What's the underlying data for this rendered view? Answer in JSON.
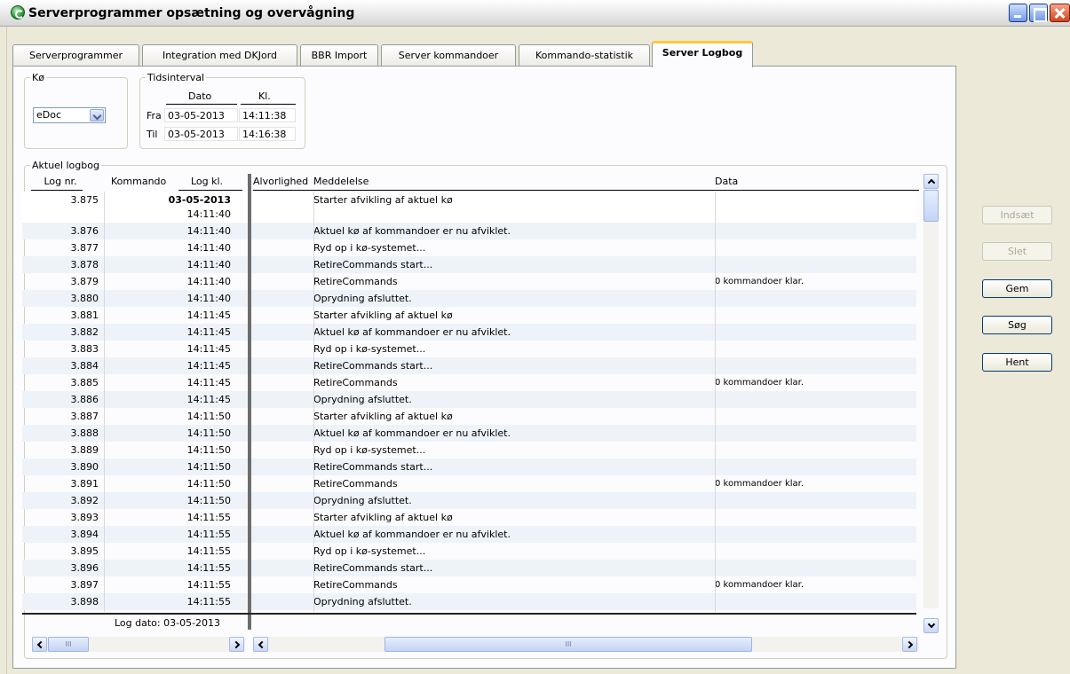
{
  "window": {
    "title": "Serverprogrammer opsætning og overvågning"
  },
  "tabs": [
    {
      "label": "Serverprogrammer"
    },
    {
      "label": "Integration med DKJord"
    },
    {
      "label": "BBR Import"
    },
    {
      "label": "Server kommandoer"
    },
    {
      "label": "Kommando-statistik"
    },
    {
      "label": "Server Logbog",
      "active": true
    }
  ],
  "queue": {
    "legend": "Kø",
    "selected": "eDoc"
  },
  "interval": {
    "legend": "Tidsinterval",
    "col_date": "Dato",
    "col_time": "Kl.",
    "from_label": "Fra",
    "from_date": "03-05-2013",
    "from_time": "14:11:38",
    "to_label": "Til",
    "to_date": "03-05-2013",
    "to_time": "14:16:38"
  },
  "log": {
    "legend": "Aktuel logbog",
    "columns": {
      "nr": "Log nr.",
      "kommando": "Kommando",
      "kl": "Log kl.",
      "alvorlighed": "Alvorlighed",
      "meddelelse": "Meddelelse",
      "data": "Data"
    },
    "first_date": "03-05-2013",
    "rows": [
      {
        "nr": "3.875",
        "kl": "14:11:40",
        "msg": "Starter afvikling af aktuel kø",
        "data": ""
      },
      {
        "nr": "3.876",
        "kl": "14:11:40",
        "msg": "Aktuel kø af kommandoer er nu afviklet.",
        "data": ""
      },
      {
        "nr": "3.877",
        "kl": "14:11:40",
        "msg": "Ryd op i kø-systemet...",
        "data": ""
      },
      {
        "nr": "3.878",
        "kl": "14:11:40",
        "msg": "RetireCommands start...",
        "data": ""
      },
      {
        "nr": "3.879",
        "kl": "14:11:40",
        "msg": "RetireCommands",
        "data": "0 kommandoer klar."
      },
      {
        "nr": "3.880",
        "kl": "14:11:40",
        "msg": "Oprydning afsluttet.",
        "data": ""
      },
      {
        "nr": "3.881",
        "kl": "14:11:45",
        "msg": "Starter afvikling af aktuel kø",
        "data": ""
      },
      {
        "nr": "3.882",
        "kl": "14:11:45",
        "msg": "Aktuel kø af kommandoer er nu afviklet.",
        "data": ""
      },
      {
        "nr": "3.883",
        "kl": "14:11:45",
        "msg": "Ryd op i kø-systemet...",
        "data": ""
      },
      {
        "nr": "3.884",
        "kl": "14:11:45",
        "msg": "RetireCommands start...",
        "data": ""
      },
      {
        "nr": "3.885",
        "kl": "14:11:45",
        "msg": "RetireCommands",
        "data": "0 kommandoer klar."
      },
      {
        "nr": "3.886",
        "kl": "14:11:45",
        "msg": "Oprydning afsluttet.",
        "data": ""
      },
      {
        "nr": "3.887",
        "kl": "14:11:50",
        "msg": "Starter afvikling af aktuel kø",
        "data": ""
      },
      {
        "nr": "3.888",
        "kl": "14:11:50",
        "msg": "Aktuel kø af kommandoer er nu afviklet.",
        "data": ""
      },
      {
        "nr": "3.889",
        "kl": "14:11:50",
        "msg": "Ryd op i kø-systemet...",
        "data": ""
      },
      {
        "nr": "3.890",
        "kl": "14:11:50",
        "msg": "RetireCommands start...",
        "data": ""
      },
      {
        "nr": "3.891",
        "kl": "14:11:50",
        "msg": "RetireCommands",
        "data": "0 kommandoer klar."
      },
      {
        "nr": "3.892",
        "kl": "14:11:50",
        "msg": "Oprydning afsluttet.",
        "data": ""
      },
      {
        "nr": "3.893",
        "kl": "14:11:55",
        "msg": "Starter afvikling af aktuel kø",
        "data": ""
      },
      {
        "nr": "3.894",
        "kl": "14:11:55",
        "msg": "Aktuel kø af kommandoer er nu afviklet.",
        "data": ""
      },
      {
        "nr": "3.895",
        "kl": "14:11:55",
        "msg": "Ryd op i kø-systemet...",
        "data": ""
      },
      {
        "nr": "3.896",
        "kl": "14:11:55",
        "msg": "RetireCommands start...",
        "data": ""
      },
      {
        "nr": "3.897",
        "kl": "14:11:55",
        "msg": "RetireCommands",
        "data": "0 kommandoer klar."
      },
      {
        "nr": "3.898",
        "kl": "14:11:55",
        "msg": "Oprydning afsluttet.",
        "data": ""
      }
    ],
    "footer": "Log dato: 03-05-2013"
  },
  "buttons": {
    "insert": "Indsæt",
    "delete": "Slet",
    "save": "Gem",
    "search": "Søg",
    "fetch": "Hent"
  },
  "scroll": {
    "left_grip": "III",
    "main_grip": "III"
  }
}
